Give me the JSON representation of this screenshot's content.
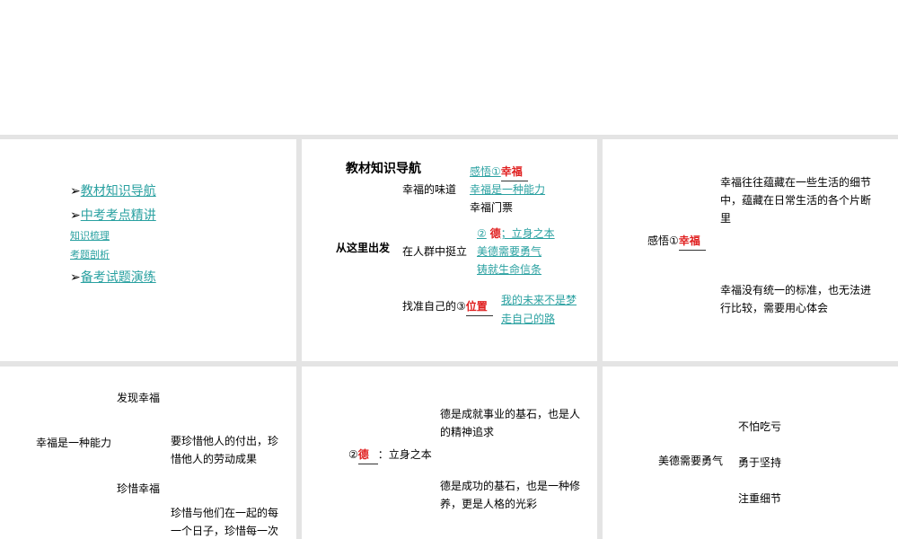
{
  "slide1": {
    "nav": [
      "教材知识导航",
      "中考考点精讲",
      "知识梳理",
      "考题剖析",
      "备考试题演练"
    ],
    "arrow": "➢"
  },
  "slide2": {
    "title": "教材知识导航",
    "root": "从这里出发",
    "b1": {
      "label": "幸福的味道",
      "items": [
        "感悟①",
        "幸福",
        "幸福是一种能力",
        "幸福门票"
      ]
    },
    "b2": {
      "label": "在人群中挺立",
      "items": [
        "②",
        "德",
        "；立身之本",
        "美德需要勇气",
        "铸就生命信条"
      ]
    },
    "b3": {
      "label": "找准自己的③",
      "blank": "位置",
      "items": [
        "我的未来不是梦",
        "走自己的路"
      ]
    }
  },
  "slide3": {
    "label": "感悟①",
    "blank": "幸福",
    "p1": "幸福往往蕴藏在一些生活的细节中，蕴藏在日常生活的各个片断里",
    "p2": "幸福没有统一的标准，也无法进行比较，需要用心体会"
  },
  "slide4": {
    "root": "幸福是一种能力",
    "a": "发现幸福",
    "b": "珍惜幸福",
    "p1": "要珍惜他人的付出，珍惜他人的劳动成果",
    "p2": "珍惜与他们在一起的每一个日子，珍惜每一次"
  },
  "slide5": {
    "num": "②",
    "blank": "德",
    "label": "：立身之本",
    "p1": "德是成就事业的基石，也是人的精神追求",
    "p2": "德是成功的基石，也是一种修养，更是人格的光彩"
  },
  "slide6": {
    "root": "美德需要勇气",
    "items": [
      "不怕吃亏",
      "勇于坚持",
      "注重细节"
    ]
  }
}
